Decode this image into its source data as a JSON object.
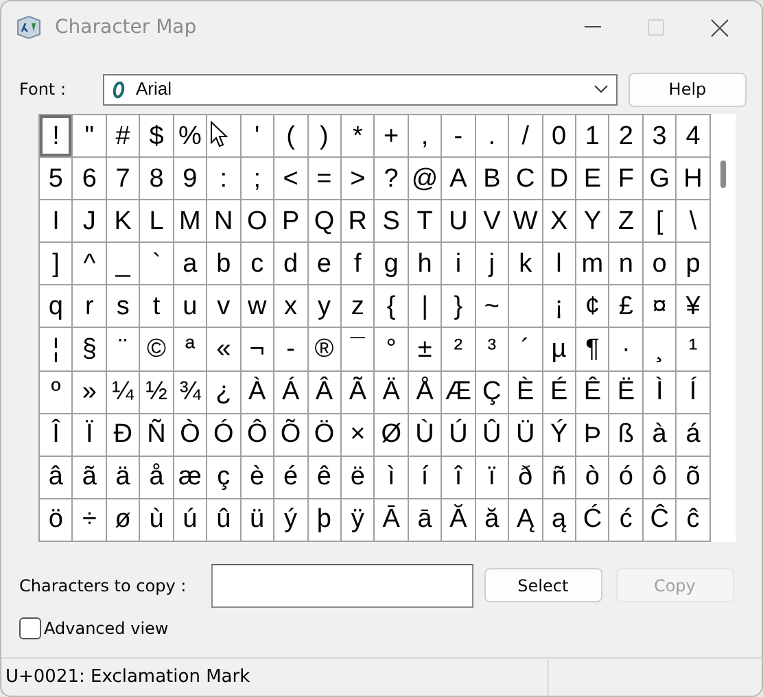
{
  "window": {
    "title": "Character Map",
    "maximize_disabled": true
  },
  "font": {
    "label": "Font :",
    "value": "Arial"
  },
  "help_button": "Help",
  "grid": {
    "rows": [
      [
        {
          "c": "!",
          "selected": true
        },
        {
          "c": "\"",
          "selected": false
        },
        {
          "c": "#",
          "selected": false
        },
        {
          "c": "$",
          "selected": false
        },
        {
          "c": "%",
          "selected": false
        },
        {
          "selected": false
        },
        {
          "c": "'",
          "selected": false
        },
        {
          "c": "(",
          "selected": false
        },
        {
          "c": ")",
          "selected": false
        },
        {
          "c": "*",
          "selected": false
        },
        {
          "c": "+",
          "selected": false
        },
        {
          "c": ",",
          "selected": false
        },
        {
          "c": "-",
          "selected": false
        },
        {
          "c": ".",
          "selected": false
        },
        {
          "c": "/",
          "selected": false
        },
        {
          "c": "0",
          "selected": false
        },
        {
          "c": "1",
          "selected": false
        },
        {
          "c": "2",
          "selected": false
        },
        {
          "c": "3",
          "selected": false
        },
        {
          "c": "4",
          "selected": false
        }
      ],
      [
        {
          "c": "5",
          "selected": false
        },
        {
          "c": "6",
          "selected": false
        },
        {
          "c": "7",
          "selected": false
        },
        {
          "c": "8",
          "selected": false
        },
        {
          "c": "9",
          "selected": false
        },
        {
          "c": ":",
          "selected": false
        },
        {
          "c": ";",
          "selected": false
        },
        {
          "c": "<",
          "selected": false
        },
        {
          "c": "=",
          "selected": false
        },
        {
          "c": ">",
          "selected": false
        },
        {
          "c": "?",
          "selected": false
        },
        {
          "c": "@",
          "selected": false
        },
        {
          "c": "A",
          "selected": false
        },
        {
          "c": "B",
          "selected": false
        },
        {
          "c": "C",
          "selected": false
        },
        {
          "c": "D",
          "selected": false
        },
        {
          "c": "E",
          "selected": false
        },
        {
          "c": "F",
          "selected": false
        },
        {
          "c": "G",
          "selected": false
        },
        {
          "c": "H",
          "selected": false
        }
      ],
      [
        {
          "c": "I",
          "selected": false
        },
        {
          "c": "J",
          "selected": false
        },
        {
          "c": "K",
          "selected": false
        },
        {
          "c": "L",
          "selected": false
        },
        {
          "c": "M",
          "selected": false
        },
        {
          "c": "N",
          "selected": false
        },
        {
          "c": "O",
          "selected": false
        },
        {
          "c": "P",
          "selected": false
        },
        {
          "c": "Q",
          "selected": false
        },
        {
          "c": "R",
          "selected": false
        },
        {
          "c": "S",
          "selected": false
        },
        {
          "c": "T",
          "selected": false
        },
        {
          "c": "U",
          "selected": false
        },
        {
          "c": "V",
          "selected": false
        },
        {
          "c": "W",
          "selected": false
        },
        {
          "c": "X",
          "selected": false
        },
        {
          "c": "Y",
          "selected": false
        },
        {
          "c": "Z",
          "selected": false
        },
        {
          "c": "[",
          "selected": false
        },
        {
          "c": "\\",
          "selected": false
        }
      ],
      [
        {
          "c": "]",
          "selected": false
        },
        {
          "c": "^",
          "selected": false
        },
        {
          "c": "_",
          "selected": false
        },
        {
          "c": "`",
          "selected": false
        },
        {
          "c": "a",
          "selected": false
        },
        {
          "c": "b",
          "selected": false
        },
        {
          "c": "c",
          "selected": false
        },
        {
          "c": "d",
          "selected": false
        },
        {
          "c": "e",
          "selected": false
        },
        {
          "c": "f",
          "selected": false
        },
        {
          "c": "g",
          "selected": false
        },
        {
          "c": "h",
          "selected": false
        },
        {
          "c": "i",
          "selected": false
        },
        {
          "c": "j",
          "selected": false
        },
        {
          "c": "k",
          "selected": false
        },
        {
          "c": "l",
          "selected": false
        },
        {
          "c": "m",
          "selected": false
        },
        {
          "c": "n",
          "selected": false
        },
        {
          "c": "o",
          "selected": false
        },
        {
          "c": "p",
          "selected": false
        }
      ],
      [
        {
          "c": "q",
          "selected": false
        },
        {
          "c": "r",
          "selected": false
        },
        {
          "c": "s",
          "selected": false
        },
        {
          "c": "t",
          "selected": false
        },
        {
          "c": "u",
          "selected": false
        },
        {
          "c": "v",
          "selected": false
        },
        {
          "c": "w",
          "selected": false
        },
        {
          "c": "x",
          "selected": false
        },
        {
          "c": "y",
          "selected": false
        },
        {
          "c": "z",
          "selected": false
        },
        {
          "c": "{",
          "selected": false
        },
        {
          "c": "|",
          "selected": false
        },
        {
          "c": "}",
          "selected": false
        },
        {
          "c": "~",
          "selected": false
        },
        {
          "selected": false
        },
        {
          "c": "¡",
          "selected": false
        },
        {
          "c": "¢",
          "selected": false
        },
        {
          "c": "£",
          "selected": false
        },
        {
          "c": "¤",
          "selected": false
        },
        {
          "c": "¥",
          "selected": false
        }
      ],
      [
        {
          "c": "¦",
          "selected": false
        },
        {
          "c": "§",
          "selected": false
        },
        {
          "c": "¨",
          "selected": false
        },
        {
          "c": "©",
          "selected": false
        },
        {
          "c": "ª",
          "selected": false
        },
        {
          "c": "«",
          "selected": false
        },
        {
          "c": "¬",
          "selected": false
        },
        {
          "c": "-",
          "selected": false
        },
        {
          "c": "®",
          "selected": false
        },
        {
          "c": "¯",
          "selected": false
        },
        {
          "c": "°",
          "selected": false
        },
        {
          "c": "±",
          "selected": false
        },
        {
          "c": "²",
          "selected": false
        },
        {
          "c": "³",
          "selected": false
        },
        {
          "c": "´",
          "selected": false
        },
        {
          "c": "µ",
          "selected": false
        },
        {
          "c": "¶",
          "selected": false
        },
        {
          "c": "·",
          "selected": false
        },
        {
          "c": "¸",
          "selected": false
        },
        {
          "c": "¹",
          "selected": false
        }
      ],
      [
        {
          "c": "º",
          "selected": false
        },
        {
          "c": "»",
          "selected": false
        },
        {
          "c": "¼",
          "selected": false
        },
        {
          "c": "½",
          "selected": false
        },
        {
          "c": "¾",
          "selected": false
        },
        {
          "c": "¿",
          "selected": false
        },
        {
          "c": "À",
          "selected": false
        },
        {
          "c": "Á",
          "selected": false
        },
        {
          "c": "Â",
          "selected": false
        },
        {
          "c": "Ã",
          "selected": false
        },
        {
          "c": "Ä",
          "selected": false
        },
        {
          "c": "Å",
          "selected": false
        },
        {
          "c": "Æ",
          "selected": false
        },
        {
          "c": "Ç",
          "selected": false
        },
        {
          "c": "È",
          "selected": false
        },
        {
          "c": "É",
          "selected": false
        },
        {
          "c": "Ê",
          "selected": false
        },
        {
          "c": "Ë",
          "selected": false
        },
        {
          "c": "Ì",
          "selected": false
        },
        {
          "c": "Í",
          "selected": false
        }
      ],
      [
        {
          "c": "Î",
          "selected": false
        },
        {
          "c": "Ï",
          "selected": false
        },
        {
          "c": "Ð",
          "selected": false
        },
        {
          "c": "Ñ",
          "selected": false
        },
        {
          "c": "Ò",
          "selected": false
        },
        {
          "c": "Ó",
          "selected": false
        },
        {
          "c": "Ô",
          "selected": false
        },
        {
          "c": "Õ",
          "selected": false
        },
        {
          "c": "Ö",
          "selected": false
        },
        {
          "c": "×",
          "selected": false
        },
        {
          "c": "Ø",
          "selected": false
        },
        {
          "c": "Ù",
          "selected": false
        },
        {
          "c": "Ú",
          "selected": false
        },
        {
          "c": "Û",
          "selected": false
        },
        {
          "c": "Ü",
          "selected": false
        },
        {
          "c": "Ý",
          "selected": false
        },
        {
          "c": "Þ",
          "selected": false
        },
        {
          "c": "ß",
          "selected": false
        },
        {
          "c": "à",
          "selected": false
        },
        {
          "c": "á",
          "selected": false
        }
      ],
      [
        {
          "c": "â",
          "selected": false
        },
        {
          "c": "ã",
          "selected": false
        },
        {
          "c": "ä",
          "selected": false
        },
        {
          "c": "å",
          "selected": false
        },
        {
          "c": "æ",
          "selected": false
        },
        {
          "c": "ç",
          "selected": false
        },
        {
          "c": "è",
          "selected": false
        },
        {
          "c": "é",
          "selected": false
        },
        {
          "c": "ê",
          "selected": false
        },
        {
          "c": "ë",
          "selected": false
        },
        {
          "c": "ì",
          "selected": false
        },
        {
          "c": "í",
          "selected": false
        },
        {
          "c": "î",
          "selected": false
        },
        {
          "c": "ï",
          "selected": false
        },
        {
          "c": "ð",
          "selected": false
        },
        {
          "c": "ñ",
          "selected": false
        },
        {
          "c": "ò",
          "selected": false
        },
        {
          "c": "ó",
          "selected": false
        },
        {
          "c": "ô",
          "selected": false
        },
        {
          "c": "õ",
          "selected": false
        }
      ],
      [
        {
          "c": "ö",
          "selected": false
        },
        {
          "c": "÷",
          "selected": false
        },
        {
          "c": "ø",
          "selected": false
        },
        {
          "c": "ù",
          "selected": false
        },
        {
          "c": "ú",
          "selected": false
        },
        {
          "c": "û",
          "selected": false
        },
        {
          "c": "ü",
          "selected": false
        },
        {
          "c": "ý",
          "selected": false
        },
        {
          "c": "þ",
          "selected": false
        },
        {
          "c": "ÿ",
          "selected": false
        },
        {
          "c": "Ā",
          "selected": false
        },
        {
          "c": "ā",
          "selected": false
        },
        {
          "c": "Ă",
          "selected": false
        },
        {
          "c": "ă",
          "selected": false
        },
        {
          "c": "Ą",
          "selected": false
        },
        {
          "c": "ą",
          "selected": false
        },
        {
          "c": "Ć",
          "selected": false
        },
        {
          "c": "ć",
          "selected": false
        },
        {
          "c": "Ĉ",
          "selected": false
        },
        {
          "c": "ĉ",
          "selected": false
        }
      ]
    ]
  },
  "copy": {
    "label": "Characters to copy :"
  },
  "buttons": [
    {
      "label": "Select",
      "disabled": false
    },
    {
      "label": "Copy",
      "disabled": true
    }
  ],
  "advanced_view": {
    "label": "Advanced view",
    "checked": false
  },
  "status_bar": "U+0021: Exclamation Mark"
}
